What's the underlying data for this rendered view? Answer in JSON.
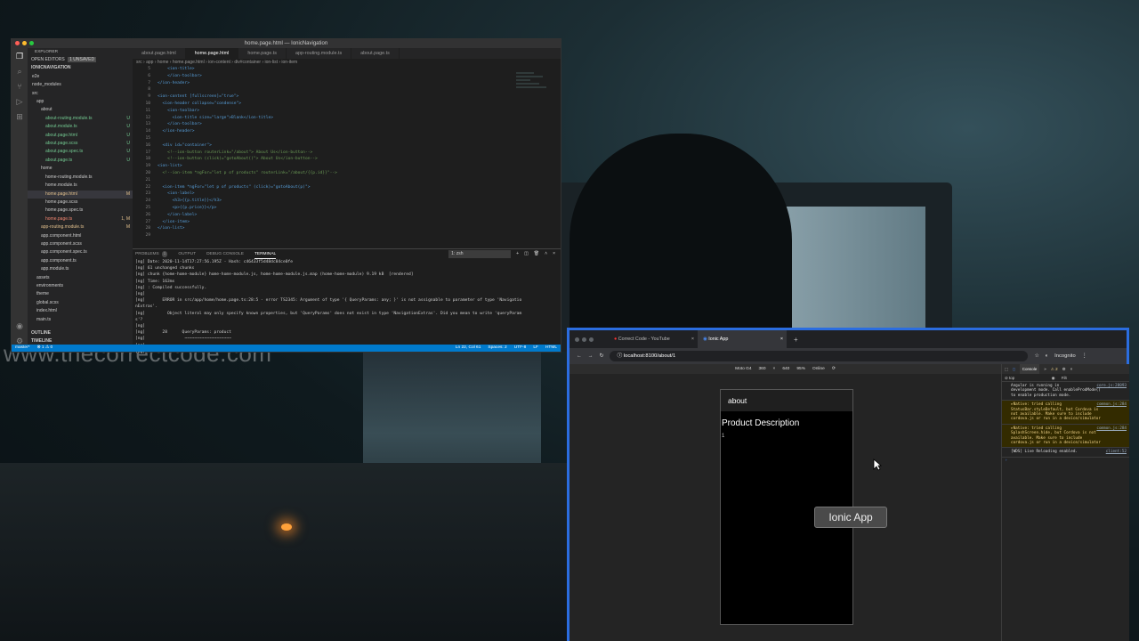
{
  "watermark": "www.thecorrectcode.com",
  "vscode": {
    "title": "home.page.html — IonicNavigation",
    "explorer": {
      "label": "EXPLORER",
      "open_editors": "OPEN EDITORS",
      "unsaved": "1 UNSAVED",
      "project": "IONICNAVIGATION",
      "items": [
        {
          "label": "e2e",
          "indent": 1,
          "badge": ""
        },
        {
          "label": "node_modules",
          "indent": 1,
          "badge": ""
        },
        {
          "label": "src",
          "indent": 1,
          "badge": ""
        },
        {
          "label": "app",
          "indent": 2,
          "badge": ""
        },
        {
          "label": "about",
          "indent": 3,
          "badge": ""
        },
        {
          "label": "about-routing.module.ts",
          "indent": 4,
          "badge": "U"
        },
        {
          "label": "about.module.ts",
          "indent": 4,
          "badge": "U"
        },
        {
          "label": "about.page.html",
          "indent": 4,
          "badge": "U"
        },
        {
          "label": "about.page.scss",
          "indent": 4,
          "badge": "U"
        },
        {
          "label": "about.page.spec.ts",
          "indent": 4,
          "badge": "U"
        },
        {
          "label": "about.page.ts",
          "indent": 4,
          "badge": "U"
        },
        {
          "label": "home",
          "indent": 3,
          "badge": ""
        },
        {
          "label": "home-routing.module.ts",
          "indent": 4,
          "badge": ""
        },
        {
          "label": "home.module.ts",
          "indent": 4,
          "badge": ""
        },
        {
          "label": "home.page.html",
          "indent": 4,
          "badge": "M"
        },
        {
          "label": "home.page.scss",
          "indent": 4,
          "badge": ""
        },
        {
          "label": "home.page.spec.ts",
          "indent": 4,
          "badge": ""
        },
        {
          "label": "home.page.ts",
          "indent": 4,
          "badge": "1, M"
        },
        {
          "label": "app-routing.module.ts",
          "indent": 3,
          "badge": "M"
        },
        {
          "label": "app.component.html",
          "indent": 3,
          "badge": ""
        },
        {
          "label": "app.component.scss",
          "indent": 3,
          "badge": ""
        },
        {
          "label": "app.component.spec.ts",
          "indent": 3,
          "badge": ""
        },
        {
          "label": "app.component.ts",
          "indent": 3,
          "badge": ""
        },
        {
          "label": "app.module.ts",
          "indent": 3,
          "badge": ""
        },
        {
          "label": "assets",
          "indent": 2,
          "badge": ""
        },
        {
          "label": "environments",
          "indent": 2,
          "badge": ""
        },
        {
          "label": "theme",
          "indent": 2,
          "badge": ""
        },
        {
          "label": "global.scss",
          "indent": 2,
          "badge": ""
        },
        {
          "label": "index.html",
          "indent": 2,
          "badge": ""
        },
        {
          "label": "main.ts",
          "indent": 2,
          "badge": ""
        }
      ],
      "outline": "OUTLINE",
      "timeline": "TIMELINE"
    },
    "tabs": [
      "about.page.html",
      "home.page.html",
      "home.page.ts",
      "app-routing.module.ts",
      "about.page.ts"
    ],
    "breadcrumb": "src › app › home › home.page.html › ion-content › div#container › ion-list › ion-item",
    "code": [
      {
        "n": "5",
        "t": "    <ion-title>"
      },
      {
        "n": "6",
        "t": "    </ion-toolbar>"
      },
      {
        "n": "7",
        "t": "</ion-header>"
      },
      {
        "n": "8",
        "t": ""
      },
      {
        "n": "9",
        "t": "<ion-content [fullscreen]=\"true\">"
      },
      {
        "n": "10",
        "t": "  <ion-header collapse=\"condense\">"
      },
      {
        "n": "11",
        "t": "    <ion-toolbar>"
      },
      {
        "n": "12",
        "t": "      <ion-title size=\"large\">Blank</ion-title>"
      },
      {
        "n": "13",
        "t": "    </ion-toolbar>"
      },
      {
        "n": "14",
        "t": "  </ion-header>"
      },
      {
        "n": "15",
        "t": ""
      },
      {
        "n": "16",
        "t": "  <div id=\"container\">"
      },
      {
        "n": "17",
        "t": "    <!--ion-button routerLink=\"/about\"> About Us</ion-button-->"
      },
      {
        "n": "18",
        "t": "    <!--ion-button (click)=\"gotoAbout()\"> About Us</ion-button-->"
      },
      {
        "n": "19",
        "t": "<ion-list>"
      },
      {
        "n": "20",
        "t": "  <!--ion-item *ngFor=\"let p of products\" routerLink=\"/about/{{p.id}}\"-->"
      },
      {
        "n": "21",
        "t": ""
      },
      {
        "n": "22",
        "t": "  <ion-item *ngFor=\"let p of products\" (click)=\"gotoAbout(p)\">"
      },
      {
        "n": "23",
        "t": "    <ion-label>"
      },
      {
        "n": "24",
        "t": "      <h3>{{p.title}}</h3>"
      },
      {
        "n": "25",
        "t": "      <p>{{p.price}}</p>"
      },
      {
        "n": "26",
        "t": "    </ion-label>"
      },
      {
        "n": "27",
        "t": "  </ion-item>"
      },
      {
        "n": "28",
        "t": "</ion-list>"
      },
      {
        "n": "29",
        "t": ""
      }
    ],
    "panel_tabs": [
      "PROBLEMS",
      "OUTPUT",
      "DEBUG CONSOLE",
      "TERMINAL"
    ],
    "problems_count": "1",
    "terminal_select": "1: zsh",
    "terminal": [
      "[ng] Date: 2020-11-14T17:27:56.195Z - Hash: c46433f5d48dc84ce0fe",
      "[ng] 61 unchanged chunks",
      "[ng] chunk {home-home-module} home-home-module.js, home-home-module.js.map (home-home-module) 9.19 kB  [rendered]",
      "[ng] Time: 163ms",
      "[ng] : Compiled successfully.",
      "[ng]",
      "[ng]       ERROR in src/app/home/home.page.ts:28:5 - error TS2345: Argument of type '{ QueryParams: any; }' is not assignable to parameter of type 'Navigatio",
      "nExtras'.",
      "[ng]         Object literal may only specify known properties, but 'QueryParams' does not exist in type 'NavigationExtras'. Did you mean to write 'queryParam",
      "s'?",
      "[ng]",
      "[ng]       28      QueryParams: product",
      "[ng]                ~~~~~~~~~~~~~~~~~~~",
      "[ng]",
      "[ng]"
    ],
    "status": {
      "branch": "master*",
      "errors": "⊗ 1 ⚠ 0",
      "position": "Ln 22, Col 61",
      "spaces": "Spaces: 2",
      "encoding": "UTF-8",
      "eol": "LF",
      "lang": "HTML"
    }
  },
  "chrome": {
    "tabs": [
      "Correct Code - YouTube",
      "Ionic App"
    ],
    "url": "localhost:8100/about/1",
    "profile": "Incognito",
    "device": {
      "name": "Moto G4",
      "width": "360",
      "height": "640",
      "zoom": "95%",
      "network": "Online"
    },
    "app": {
      "toolbar_title": "about",
      "heading": "Product Description",
      "value": "1"
    },
    "toast": "Ionic App",
    "console": {
      "tab": "Console",
      "warn_count": "2",
      "context": "top",
      "filter": "Filt",
      "messages": [
        {
          "type": "info",
          "text": "Angular is running in\ndevelopment mode. Call enableProdMode()\nto enable production mode.",
          "src": "core.js:28093"
        },
        {
          "type": "warn",
          "text": "▸Native: tried calling\nStatusBar.styleDefault, but Cordova is\nnot available. Make sure to include\ncordova.js or run in a device/simulator",
          "src": "common.js:284"
        },
        {
          "type": "warn",
          "text": "▸Native: tried calling\nSplashScreen.hide, but Cordova is not\navailable. Make sure to include\ncordova.js or run in a device/simulator",
          "src": "common.js:284"
        },
        {
          "type": "info",
          "text": "[WDS] Live Reloading enabled.",
          "src": "client:52"
        }
      ]
    }
  }
}
